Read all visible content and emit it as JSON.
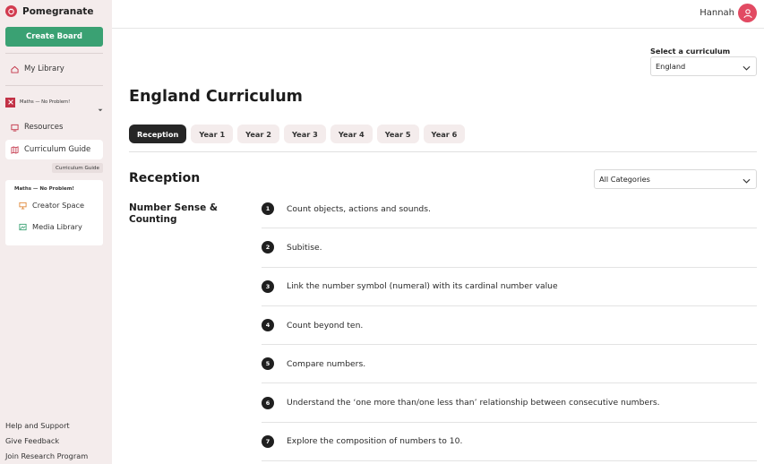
{
  "app": {
    "name": "Pomegranate"
  },
  "sidebar": {
    "create_label": "Create Board",
    "my_library": "My Library",
    "brand_label": "Maths — No Problem!",
    "items": [
      {
        "label": "Resources",
        "icon": "resources-icon"
      },
      {
        "label": "Curriculum Guide",
        "icon": "map-icon",
        "active": true
      }
    ],
    "tooltip": "Curriculum Guide",
    "sub_panel": {
      "title": "Maths — No Problem!",
      "items": [
        {
          "label": "Creator Space",
          "icon": "creator-space-icon"
        },
        {
          "label": "Media Library",
          "icon": "media-library-icon"
        }
      ]
    },
    "footer": [
      "Help and Support",
      "Give Feedback",
      "Join Research Program"
    ]
  },
  "header": {
    "user_name": "Hannah"
  },
  "curriculum_select": {
    "label": "Select a curriculum",
    "value": "England"
  },
  "page_title": "England Curriculum",
  "tabs": [
    "Reception",
    "Year 1",
    "Year 2",
    "Year 3",
    "Year 4",
    "Year 5",
    "Year 6"
  ],
  "active_tab": "Reception",
  "section": {
    "title": "Reception",
    "category_value": "All Categories"
  },
  "group": {
    "title": "Number Sense & Counting"
  },
  "objectives": [
    {
      "num": "1",
      "text": "Count objects, actions and sounds."
    },
    {
      "num": "2",
      "text": "Subitise."
    },
    {
      "num": "3",
      "text": "Link the number symbol (numeral) with its cardinal number value"
    },
    {
      "num": "4",
      "text": "Count beyond ten."
    },
    {
      "num": "5",
      "text": "Compare numbers."
    },
    {
      "num": "6",
      "text": "Understand the ‘one more than/one less than’ relationship between consecutive numbers."
    },
    {
      "num": "7",
      "text": "Explore the composition of numbers to 10."
    }
  ],
  "colors": {
    "brand": "#d23b4f",
    "primary_button": "#3aa173",
    "sidebar_bg": "#f4ecec",
    "active_tab": "#262626"
  }
}
